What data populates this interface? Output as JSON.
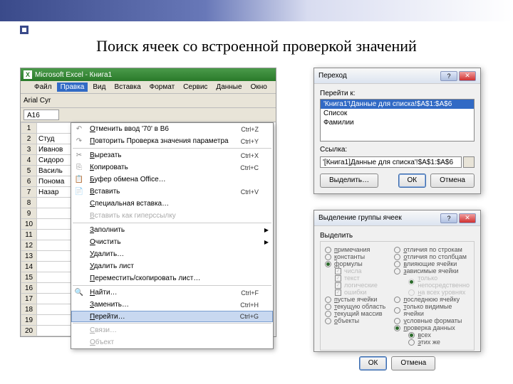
{
  "slide": {
    "title": "Поиск ячеек со встроенной проверкой значений"
  },
  "excel": {
    "title": "Microsoft Excel - Книга1",
    "menubar": [
      "Файл",
      "Правка",
      "Вид",
      "Вставка",
      "Формат",
      "Сервис",
      "Данные",
      "Окно"
    ],
    "open_menu_index": 1,
    "font": "Arial Cyr",
    "namebox": "A16",
    "rows": [
      "",
      "Студ",
      "Иванов",
      "Сидоро",
      "Василь",
      "Понома",
      "Назар",
      "",
      "",
      "",
      "",
      "",
      "",
      "",
      "",
      "",
      "",
      "",
      "",
      ""
    ]
  },
  "menu": {
    "items": [
      {
        "icon": "↶",
        "label": "Отменить ввод '70' в B6",
        "key": "Ctrl+Z"
      },
      {
        "icon": "↷",
        "label": "Повторить Проверка значения параметра",
        "key": "Ctrl+Y"
      },
      {
        "sep": true
      },
      {
        "icon": "✂",
        "label": "Вырезать",
        "key": "Ctrl+X"
      },
      {
        "icon": "⎘",
        "label": "Копировать",
        "key": "Ctrl+C"
      },
      {
        "icon": "📋",
        "label": "Буфер обмена Office…",
        "key": ""
      },
      {
        "icon": "📄",
        "label": "Вставить",
        "key": "Ctrl+V"
      },
      {
        "icon": "",
        "label": "Специальная вставка…",
        "key": ""
      },
      {
        "icon": "",
        "label": "Вставить как гиперссылку",
        "key": "",
        "disabled": true
      },
      {
        "sep": true
      },
      {
        "icon": "",
        "label": "Заполнить",
        "key": "",
        "arrow": true
      },
      {
        "icon": "",
        "label": "Очистить",
        "key": "",
        "arrow": true
      },
      {
        "icon": "",
        "label": "Удалить…",
        "key": ""
      },
      {
        "icon": "",
        "label": "Удалить лист",
        "key": ""
      },
      {
        "icon": "",
        "label": "Переместить/скопировать лист…",
        "key": ""
      },
      {
        "sep": true
      },
      {
        "icon": "🔍",
        "label": "Найти…",
        "key": "Ctrl+F"
      },
      {
        "icon": "",
        "label": "Заменить…",
        "key": "Ctrl+H"
      },
      {
        "icon": "",
        "label": "Перейти…",
        "key": "Ctrl+G",
        "highlight": true
      },
      {
        "sep": true
      },
      {
        "icon": "",
        "label": "Связи…",
        "key": "",
        "disabled": true
      },
      {
        "icon": "",
        "label": "Объект",
        "key": "",
        "disabled": true
      }
    ]
  },
  "goto": {
    "title": "Переход",
    "label_list": "Перейти к:",
    "items": [
      "'Книга1'!Данные для списка!$A$1:$A$6",
      "Список",
      "Фамилии"
    ],
    "label_ref": "Ссылка:",
    "ref_value": "'[Книга1]Данные для списка'!$A$1:$A$6",
    "btn_select": "Выделить…",
    "btn_ok": "ОК",
    "btn_cancel": "Отмена"
  },
  "special": {
    "title": "Выделение группы ячеек",
    "label": "Выделить",
    "left": [
      {
        "label": "примечания",
        "on": false
      },
      {
        "label": "константы",
        "on": false
      },
      {
        "label": "формулы",
        "on": true,
        "subs": [
          {
            "label": "числа",
            "checked": true,
            "dis": true
          },
          {
            "label": "текст",
            "checked": true,
            "dis": true
          },
          {
            "label": "логические",
            "checked": true,
            "dis": true
          },
          {
            "label": "ошибки",
            "checked": true,
            "dis": true
          }
        ]
      },
      {
        "label": "пустые ячейки",
        "on": false
      },
      {
        "label": "текущую область",
        "on": false
      },
      {
        "label": "текущий массив",
        "on": false
      },
      {
        "label": "объекты",
        "on": false
      }
    ],
    "right": [
      {
        "label": "отличия по строкам",
        "on": false
      },
      {
        "label": "отличия по столбцам",
        "on": false
      },
      {
        "label": "влияющие ячейки",
        "on": false
      },
      {
        "label": "зависимые ячейки",
        "on": false,
        "subs_r": [
          {
            "label": "только непосредственно",
            "on": true,
            "dis": true
          },
          {
            "label": "на всех уровнях",
            "on": false,
            "dis": true
          }
        ]
      },
      {
        "label": "последнюю ячейку",
        "on": false
      },
      {
        "label": "только видимые ячейки",
        "on": false
      },
      {
        "label": "условные форматы",
        "on": false
      },
      {
        "label": "проверка данных",
        "on": true,
        "subs_r": [
          {
            "label": "всех",
            "on": true
          },
          {
            "label": "этих же",
            "on": false
          }
        ]
      }
    ],
    "btn_ok": "ОК",
    "btn_cancel": "Отмена"
  }
}
